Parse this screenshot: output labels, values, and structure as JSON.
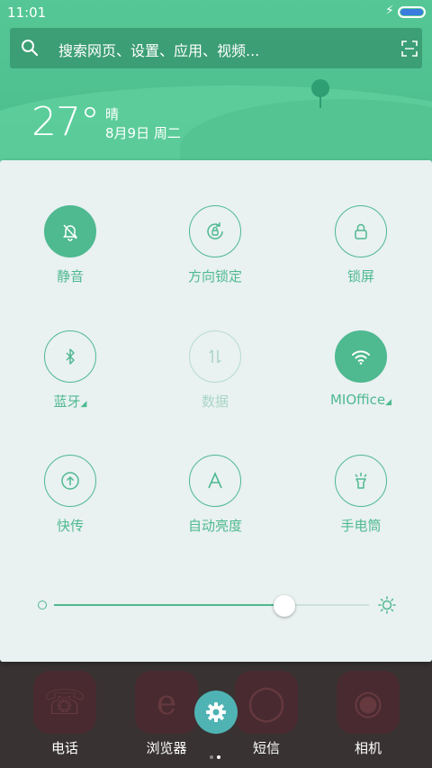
{
  "status": {
    "time": "11:01"
  },
  "search": {
    "placeholder": "搜索网页、设置、应用、视频..."
  },
  "weather": {
    "temperature": "27°",
    "condition": "晴",
    "date": "8月9日 周二"
  },
  "toggles": [
    {
      "id": "mute",
      "label": "静音",
      "icon": "bell-off-icon",
      "state": "on"
    },
    {
      "id": "rotation",
      "label": "方向锁定",
      "icon": "rotation-lock-icon",
      "state": "off"
    },
    {
      "id": "lock",
      "label": "锁屏",
      "icon": "lock-icon",
      "state": "off"
    },
    {
      "id": "bluetooth",
      "label": "蓝牙",
      "icon": "bluetooth-icon",
      "state": "off",
      "has_menu": true
    },
    {
      "id": "data",
      "label": "数据",
      "icon": "data-arrows-icon",
      "state": "disabled"
    },
    {
      "id": "wifi",
      "label": "MIOffice",
      "icon": "wifi-icon",
      "state": "on",
      "has_menu": true
    },
    {
      "id": "share",
      "label": "快传",
      "icon": "quick-share-icon",
      "state": "off"
    },
    {
      "id": "auto_brightness",
      "label": "自动亮度",
      "icon": "auto-brightness-icon",
      "state": "off"
    },
    {
      "id": "flashlight",
      "label": "手电筒",
      "icon": "flashlight-icon",
      "state": "off"
    }
  ],
  "brightness": {
    "value_fraction": 0.73
  },
  "dock": [
    {
      "label": "电话",
      "icon": "phone-icon"
    },
    {
      "label": "浏览器",
      "icon": "browser-icon"
    },
    {
      "label": "短信",
      "icon": "message-icon"
    },
    {
      "label": "相机",
      "icon": "camera-icon"
    }
  ],
  "colors": {
    "accent": "#4fb990",
    "header": "#55c796",
    "panel": "#e9f1f1"
  }
}
